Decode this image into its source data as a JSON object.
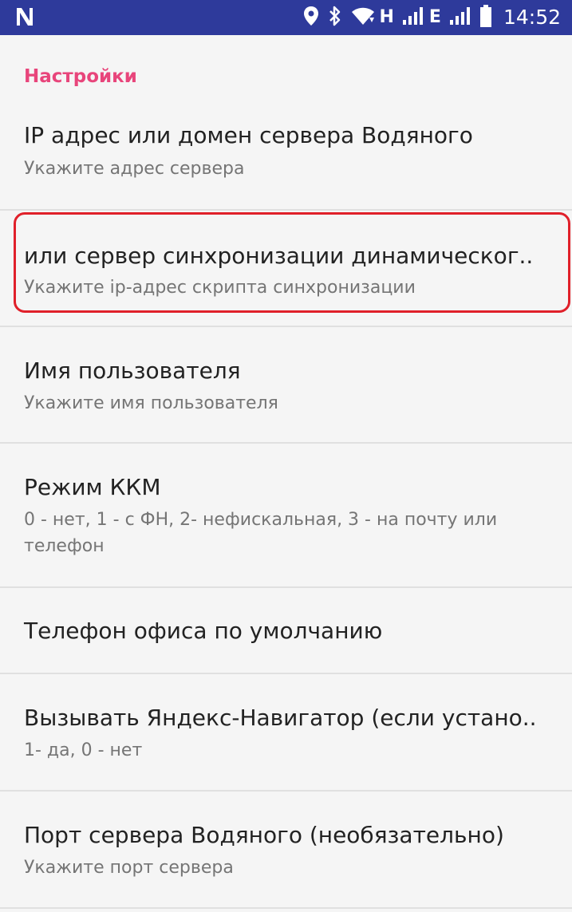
{
  "status_bar": {
    "left_icon": "n-logo-icon",
    "network_letter_1": "H",
    "network_letter_2": "E",
    "time": "14:52",
    "icons": [
      "location-icon",
      "bluetooth-icon",
      "wifi-icon",
      "signal-icon",
      "signal-icon",
      "battery-icon"
    ]
  },
  "settings": {
    "section_title": "Настройки",
    "items": [
      {
        "title": "IP адрес или домен сервера Водяного",
        "summary": "Укажите адрес сервера"
      },
      {
        "title": "или сервер синхронизации динамическог..",
        "summary": "Укажите ip-адрес скрипта синхронизации",
        "highlighted": true
      },
      {
        "title": "Имя пользователя",
        "summary": "Укажите имя пользователя"
      },
      {
        "title": "Режим ККМ",
        "summary": "0 - нет, 1 - с ФН, 2- нефискальная, 3 - на почту или телефон"
      },
      {
        "title": "Телефон офиса по умолчанию",
        "summary": ""
      },
      {
        "title": "Вызывать Яндекс-Навигатор (если устано..",
        "summary": "1- да, 0 - нет"
      },
      {
        "title": "Порт сервера Водяного (необязательно)",
        "summary": "Укажите порт сервера"
      }
    ]
  },
  "colors": {
    "status_bar": "#2e3a9b",
    "accent": "#e8457b",
    "highlight_border": "#e0202a",
    "background": "#f5f5f5"
  }
}
